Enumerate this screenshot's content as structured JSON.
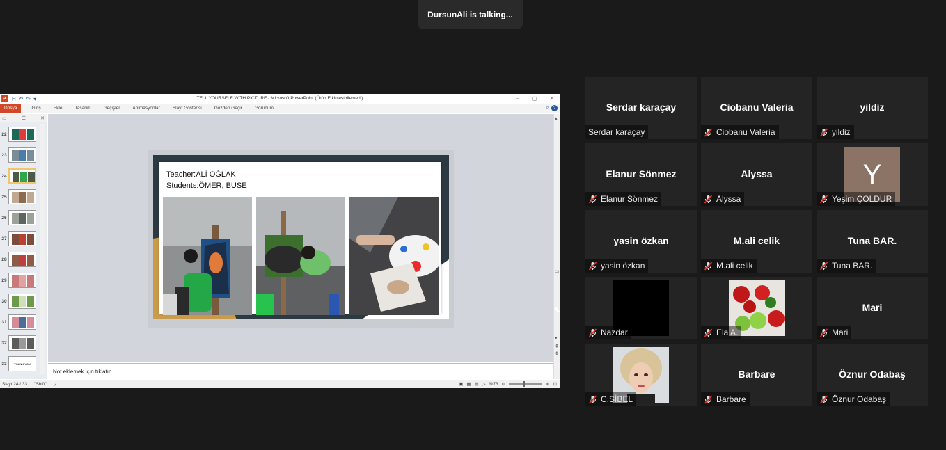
{
  "banner": {
    "talking": "DursunAli is talking..."
  },
  "ppt": {
    "window_title": "TELL YOURSELF WITH PICTURE  -  Microsoft PowerPoint (Ürün Etkinleştirilemedi)",
    "logo": "P",
    "qat": [
      "H",
      "↶",
      "↷",
      "▾"
    ],
    "ribbon": {
      "file_tab": "Dosya",
      "tabs": [
        "Giriş",
        "Ekle",
        "Tasarım",
        "Geçişler",
        "Animasyonlar",
        "Slayt Gösterisi",
        "Gözden Geçir",
        "Görünüm"
      ]
    },
    "thumbs": [
      {
        "num": "22"
      },
      {
        "num": "23"
      },
      {
        "num": "24"
      },
      {
        "num": "25"
      },
      {
        "num": "26"
      },
      {
        "num": "27"
      },
      {
        "num": "28"
      },
      {
        "num": "29"
      },
      {
        "num": "30"
      },
      {
        "num": "31"
      },
      {
        "num": "32"
      },
      {
        "num": "33",
        "text": "THANK YOU"
      }
    ],
    "slide": {
      "teacher": "Teacher:ALİ OĞLAK",
      "students": "Students:ÖMER, BUSE"
    },
    "notes_placeholder": "Not eklemek için tıklatın",
    "status": {
      "slide_info": "Slayt 24 / 33",
      "theme": "\"Shift\"",
      "zoom": "%73"
    },
    "colors": {
      "accent": "#d24726",
      "ribbon_blue": "#2b579a"
    }
  },
  "participants": [
    {
      "display": "Serdar karaçay",
      "label": "Serdar karaçay",
      "muted": false
    },
    {
      "display": "Ciobanu Valeria",
      "label": "Ciobanu Valeria",
      "muted": true
    },
    {
      "display": "yildiz",
      "label": "yildiz",
      "muted": true
    },
    {
      "display": "Elanur Sönmez",
      "label": "Elanur Sönmez",
      "muted": true
    },
    {
      "display": "Alyssa",
      "label": "Alyssa",
      "muted": true
    },
    {
      "display": "",
      "label": "Yeşim ÇOLDUR",
      "muted": true,
      "avatar": "Y"
    },
    {
      "display": "yasin özkan",
      "label": "yasin özkan",
      "muted": true
    },
    {
      "display": "M.ali celik",
      "label": "M.ali celik",
      "muted": true
    },
    {
      "display": "Tuna BAR.",
      "label": "Tuna BAR.",
      "muted": true
    },
    {
      "display": "",
      "label": "Nazdar",
      "muted": true,
      "photo": "black"
    },
    {
      "display": "",
      "label": "Ela A.",
      "muted": true,
      "photo": "strawberries"
    },
    {
      "display": "Mari",
      "label": "Mari",
      "muted": true
    },
    {
      "display": "",
      "label": "C.SİBEL",
      "muted": true,
      "photo": "portrait"
    },
    {
      "display": "Barbare",
      "label": "Barbare",
      "muted": true
    },
    {
      "display": "Öznur Odabaş",
      "label": "Öznur Odabaş",
      "muted": true
    }
  ]
}
